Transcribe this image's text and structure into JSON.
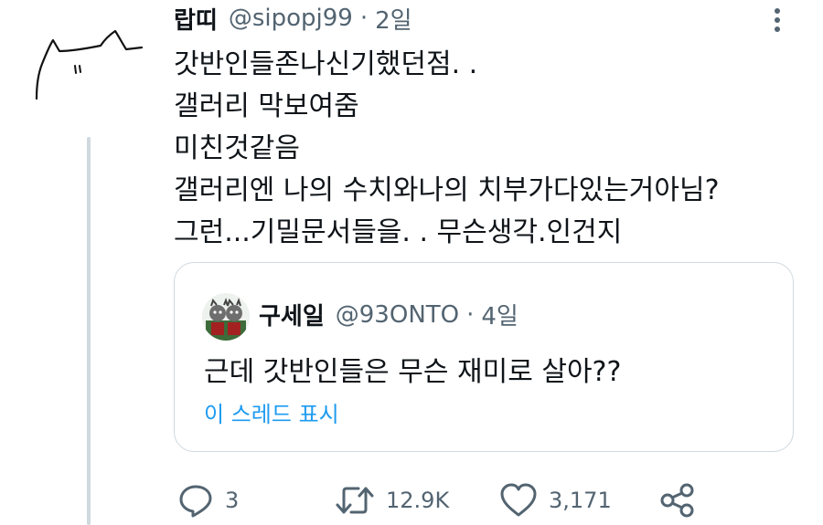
{
  "tweet": {
    "display_name": "랍띠",
    "handle": "@sipopj99",
    "separator": "·",
    "time": "2일",
    "text_lines": [
      "갓반인들존나신기했던점. .",
      "갤러리 막보여줌",
      "미친것같음",
      "갤러리엔 나의 수치와나의 치부가다있는거아님?",
      "그런...기밀문서들을. . 무슨생각.인건지"
    ]
  },
  "quote": {
    "display_name": "구세일",
    "handle": "@93ONTO",
    "separator": "·",
    "time": "4일",
    "text": "근데 갓반인들은 무슨 재미로 살아??",
    "show_thread_label": "이 스레드 표시"
  },
  "actions": {
    "reply_count": "3",
    "retweet_count": "12.9K",
    "like_count": "3,171"
  },
  "colors": {
    "text": "#0f1419",
    "secondary": "#536471",
    "link": "#1d9bf0",
    "border": "#cfd9de"
  },
  "icons": [
    "more-vertical-icon",
    "reply-icon",
    "retweet-icon",
    "like-icon",
    "share-icon"
  ]
}
